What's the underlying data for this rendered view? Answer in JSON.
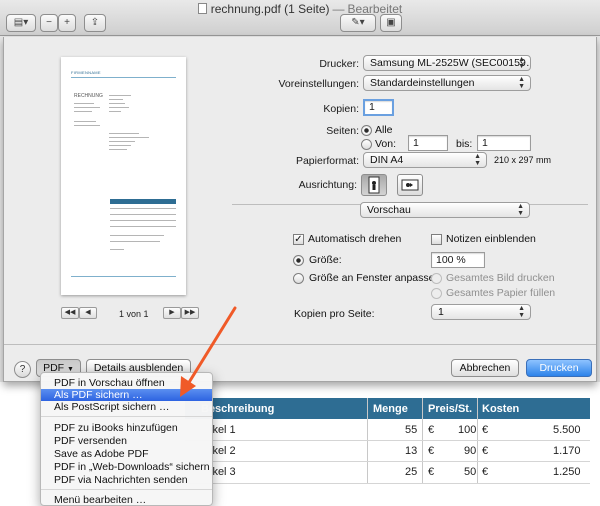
{
  "window": {
    "title": "rechnung.pdf (1 Seite)",
    "title_sep": "—",
    "title_state": "Bearbeitet"
  },
  "preview": {
    "firm": "FIRMENNAME",
    "heading": "RECHNUNG",
    "page_label": "1 von 1"
  },
  "printer": {
    "label": "Drucker:",
    "value": "Samsung ML-2525W (SEC00159…"
  },
  "presets": {
    "label": "Voreinstellungen:",
    "value": "Standardeinstellungen"
  },
  "copies": {
    "label": "Kopien:",
    "value": "1"
  },
  "pages": {
    "label": "Seiten:",
    "all": "Alle",
    "from": "Von:",
    "from_value": "1",
    "to": "bis:",
    "to_value": "1"
  },
  "paper": {
    "label": "Papierformat:",
    "value": "DIN A4",
    "size": "210 x 297 mm"
  },
  "orientation": {
    "label": "Ausrichtung:"
  },
  "section": {
    "value": "Vorschau"
  },
  "options": {
    "auto_rotate": "Automatisch drehen",
    "show_notes": "Notizen einblenden",
    "size": "Größe:",
    "size_value": "100 %",
    "fit": "Größe an Fenster anpasser",
    "print_entire": "Gesamtes Bild drucken",
    "fill_paper": "Gesamtes Papier füllen",
    "pages_per_sheet_label": "Kopien pro Seite:",
    "pages_per_sheet_value": "1"
  },
  "footer": {
    "help": "?",
    "pdf": "PDF",
    "details": "Details ausblenden",
    "cancel": "Abbrechen",
    "print": "Drucken"
  },
  "pdf_menu": {
    "items": [
      "PDF in Vorschau öffnen",
      "Als PDF sichern …",
      "Als PostScript sichern …",
      "PDF zu iBooks hinzufügen",
      "PDF versenden",
      "Save as Adobe PDF",
      "PDF in „Web-Downloads“ sichern",
      "PDF via Nachrichten senden",
      "Menü bearbeiten …"
    ],
    "highlighted_index": 1
  },
  "background_invoice": {
    "headers": [
      "Beschreibung",
      "Menge",
      "Preis/St.",
      "Kosten"
    ],
    "rows": [
      {
        "desc": "ikel 1",
        "qty": "55",
        "cur1": "€",
        "price": "100",
        "cur2": "€",
        "cost": "5.500"
      },
      {
        "desc": "ikel 2",
        "qty": "13",
        "cur1": "€",
        "price": "90",
        "cur2": "€",
        "cost": "1.170"
      },
      {
        "desc": "ikel 3",
        "qty": "25",
        "cur1": "€",
        "price": "50",
        "cur2": "€",
        "cost": "1.250"
      }
    ]
  },
  "colors": {
    "accent": "#2d63e1",
    "invoice_header": "#2e6d93",
    "annotation_arrow": "#f05a28"
  }
}
